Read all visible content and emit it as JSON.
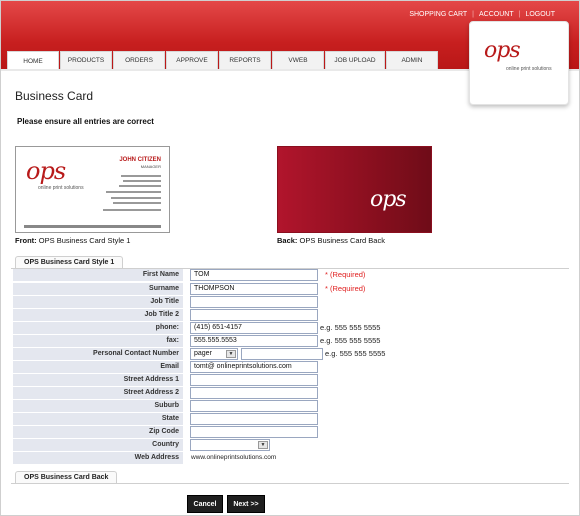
{
  "header": {
    "links": [
      "SHOPPING CART",
      "ACCOUNT",
      "LOGOUT"
    ],
    "nav": [
      "HOME",
      "PRODUCTS",
      "ORDERS",
      "APPROVE",
      "REPORTS",
      "VWEB",
      "JOB UPLOAD",
      "ADMIN"
    ],
    "logo_text": "ops",
    "logo_tagline": "online print solutions"
  },
  "page": {
    "title": "Business Card",
    "subtitle": "Please ensure all entries are correct"
  },
  "preview": {
    "front_caption_bold": "Front:",
    "front_caption": "OPS Business Card Style 1",
    "back_caption_bold": "Back:",
    "back_caption": "OPS Business Card Back",
    "front_card": {
      "logo": "ops",
      "tagline": "online print solutions",
      "name": "JOHN CITIZEN",
      "title": "MANAGER"
    },
    "back_card": {
      "logo": "ops"
    }
  },
  "sections": {
    "style_tab": "OPS Business Card Style 1",
    "back_tab": "OPS Business Card Back"
  },
  "form": {
    "first_name": {
      "label": "First Name",
      "value": "TOM",
      "required": "* (Required)"
    },
    "surname": {
      "label": "Surname",
      "value": "THOMPSON",
      "required": "* (Required)"
    },
    "job_title": {
      "label": "Job Title",
      "value": ""
    },
    "job_title_2": {
      "label": "Job Title 2",
      "value": ""
    },
    "phone": {
      "label": "phone:",
      "value": "(415) 651-4157",
      "example": "e.g. 555 555 5555"
    },
    "fax": {
      "label": "fax:",
      "value": "555.555.5553",
      "example": "e.g. 555 555 5555"
    },
    "personal_contact": {
      "label": "Personal Contact Number",
      "type_value": "pager",
      "value": "",
      "example": "e.g. 555 555 5555"
    },
    "email": {
      "label": "Email",
      "value": "tomt@ onlineprintsolutions.com"
    },
    "street_1": {
      "label": "Street Address 1",
      "value": ""
    },
    "street_2": {
      "label": "Street Address 2",
      "value": ""
    },
    "suburb": {
      "label": "Suburb",
      "value": ""
    },
    "state": {
      "label": "State",
      "value": ""
    },
    "zip": {
      "label": "Zip Code",
      "value": ""
    },
    "country": {
      "label": "Country",
      "value": ""
    },
    "web_address": {
      "label": "Web Address",
      "value": "www.onlineprintsolutions.com"
    }
  },
  "buttons": {
    "cancel": "Cancel",
    "next": "Next >>"
  },
  "colors": {
    "brand_red": "#c71f1f",
    "required_red": "#e02020",
    "label_bg": "#e4e7ef"
  }
}
